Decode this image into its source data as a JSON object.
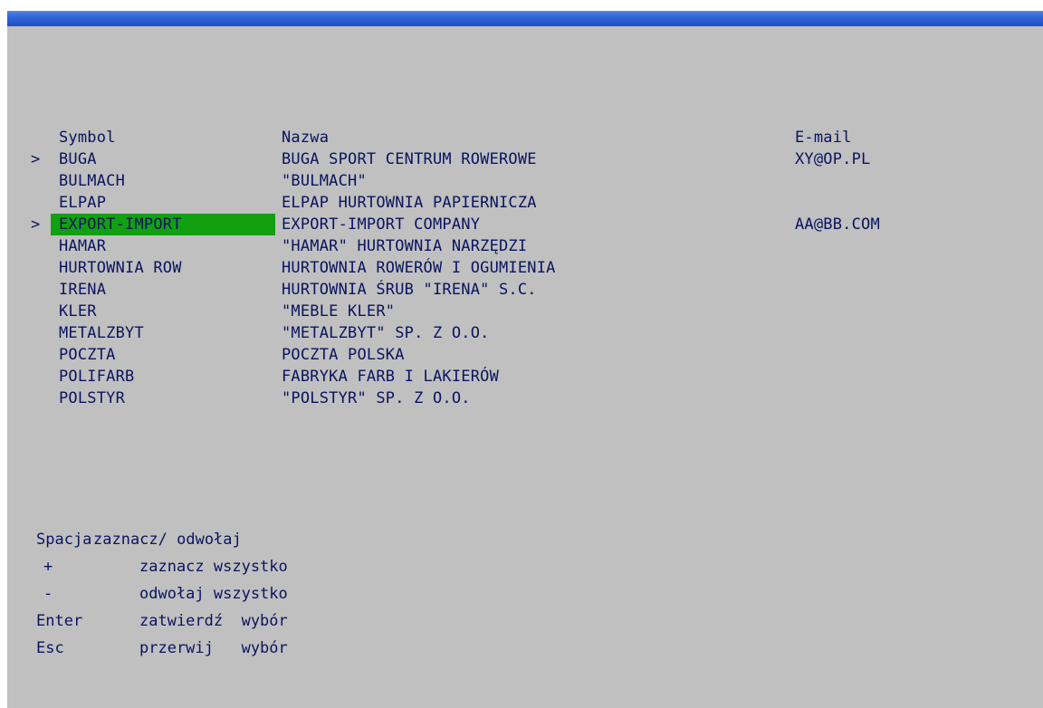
{
  "headers": {
    "symbol": "Symbol",
    "nazwa": "Nazwa",
    "email": "E-mail"
  },
  "rows": [
    {
      "marker": ">",
      "symbol": "BUGA",
      "nazwa": "BUGA SPORT CENTRUM ROWEROWE",
      "email": "XY@OP.PL",
      "selected": true,
      "highlighted": false
    },
    {
      "marker": "",
      "symbol": "BULMACH",
      "nazwa": "\"BULMACH\"",
      "email": "",
      "selected": false,
      "highlighted": false
    },
    {
      "marker": "",
      "symbol": "ELPAP",
      "nazwa": "ELPAP HURTOWNIA PAPIERNICZA",
      "email": "",
      "selected": false,
      "highlighted": false
    },
    {
      "marker": ">",
      "symbol": "EXPORT-IMPORT",
      "nazwa": "EXPORT-IMPORT COMPANY",
      "email": "AA@BB.COM",
      "selected": true,
      "highlighted": true
    },
    {
      "marker": "",
      "symbol": "HAMAR",
      "nazwa": "\"HAMAR\" HURTOWNIA NARZĘDZI",
      "email": "",
      "selected": false,
      "highlighted": false
    },
    {
      "marker": "",
      "symbol": "HURTOWNIA ROW",
      "nazwa": "HURTOWNIA ROWERÓW I OGUMIENIA",
      "email": "",
      "selected": false,
      "highlighted": false
    },
    {
      "marker": "",
      "symbol": "IRENA",
      "nazwa": "HURTOWNIA ŚRUB \"IRENA\" S.C.",
      "email": "",
      "selected": false,
      "highlighted": false
    },
    {
      "marker": "",
      "symbol": "KLER",
      "nazwa": "\"MEBLE KLER\"",
      "email": "",
      "selected": false,
      "highlighted": false
    },
    {
      "marker": "",
      "symbol": "METALZBYT",
      "nazwa": "\"METALZBYT\" SP. Z O.O.",
      "email": "",
      "selected": false,
      "highlighted": false
    },
    {
      "marker": "",
      "symbol": "POCZTA",
      "nazwa": "POCZTA POLSKA",
      "email": "",
      "selected": false,
      "highlighted": false
    },
    {
      "marker": "",
      "symbol": "POLIFARB",
      "nazwa": "FABRYKA FARB I LAKIERÓW",
      "email": "",
      "selected": false,
      "highlighted": false
    },
    {
      "marker": "",
      "symbol": "POLSTYR",
      "nazwa": "\"POLSTYR\" SP. Z O.O.",
      "email": "",
      "selected": false,
      "highlighted": false
    }
  ],
  "help": [
    {
      "key": "Spacja",
      "action": "zaznacz/ odwołaj"
    },
    {
      "key": "+",
      "action": "zaznacz wszystko"
    },
    {
      "key": "-",
      "action": "odwołaj wszystko"
    },
    {
      "key": "Enter",
      "action": "zatwierdź  wybór"
    },
    {
      "key": "Esc",
      "action": "przerwij   wybór"
    }
  ],
  "colors": {
    "background": "#c0c0c0",
    "text": "#0a1460",
    "highlight": "#10a010",
    "titlebar": "#2f63d6"
  }
}
